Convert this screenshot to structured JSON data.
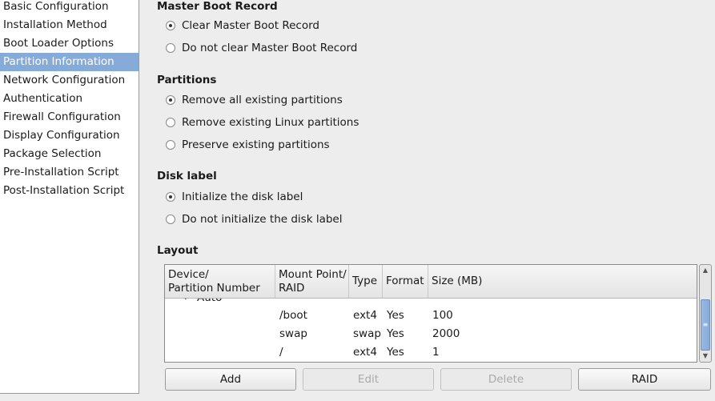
{
  "sidebar": {
    "items": [
      {
        "label": "Basic Configuration"
      },
      {
        "label": "Installation Method"
      },
      {
        "label": "Boot Loader Options"
      },
      {
        "label": "Partition Information",
        "selected": true
      },
      {
        "label": "Network Configuration"
      },
      {
        "label": "Authentication"
      },
      {
        "label": "Firewall Configuration"
      },
      {
        "label": "Display Configuration"
      },
      {
        "label": "Package Selection"
      },
      {
        "label": "Pre-Installation Script"
      },
      {
        "label": "Post-Installation Script"
      }
    ]
  },
  "mbr": {
    "title": "Master Boot Record",
    "options": [
      {
        "label": "Clear Master Boot Record",
        "checked": true
      },
      {
        "label": "Do not clear Master Boot Record",
        "checked": false
      }
    ]
  },
  "partitions": {
    "title": "Partitions",
    "options": [
      {
        "label": "Remove all existing partitions",
        "checked": true
      },
      {
        "label": "Remove existing Linux partitions",
        "checked": false
      },
      {
        "label": "Preserve existing partitions",
        "checked": false
      }
    ]
  },
  "disklabel": {
    "title": "Disk label",
    "options": [
      {
        "label": "Initialize the disk label",
        "checked": true
      },
      {
        "label": "Do not initialize the disk label",
        "checked": false
      }
    ]
  },
  "layout": {
    "title": "Layout",
    "columns": [
      "Device/\nPartition Number",
      "Mount Point/\nRAID",
      "Type",
      "Format",
      "Size (MB)"
    ],
    "group": "Auto",
    "rows": [
      [
        "",
        "/boot",
        "ext4",
        "Yes",
        "100"
      ],
      [
        "",
        "swap",
        "swap",
        "Yes",
        "2000"
      ],
      [
        "",
        "/",
        "ext4",
        "Yes",
        "1"
      ]
    ]
  },
  "buttons": {
    "add": "Add",
    "edit": "Edit",
    "delete": "Delete",
    "raid": "RAID"
  },
  "colors": {
    "selection": "#86abd9",
    "background": "#ededed"
  }
}
